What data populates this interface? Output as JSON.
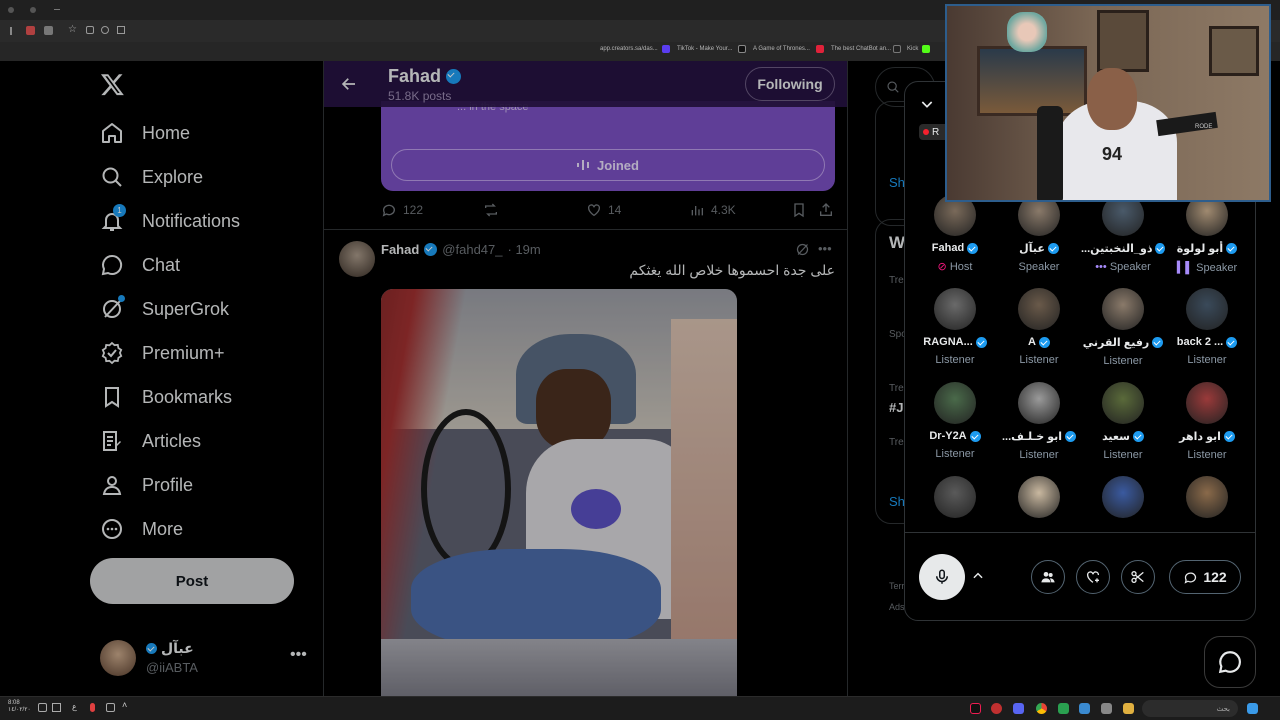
{
  "browser": {
    "bookmarks": [
      {
        "label": "app.creators.sa/das...",
        "icon_color": "#444444"
      },
      {
        "label": "TikTok - Make Your...",
        "icon_color": "#5a3df0"
      },
      {
        "label": "A Game of Thrones...",
        "icon_color": "#111111"
      },
      {
        "label": "The best ChatBot an...",
        "icon_color": "#e0223a"
      },
      {
        "label": "Kick",
        "icon_color": "#53fc18"
      }
    ]
  },
  "nav": {
    "items": [
      {
        "label": "Home",
        "icon": "home-icon"
      },
      {
        "label": "Explore",
        "icon": "search-icon"
      },
      {
        "label": "Notifications",
        "icon": "bell-icon",
        "badge": "1"
      },
      {
        "label": "Chat",
        "icon": "chat-icon"
      },
      {
        "label": "SuperGrok",
        "icon": "grok-icon"
      },
      {
        "label": "Premium+",
        "icon": "premium-icon"
      },
      {
        "label": "Bookmarks",
        "icon": "bookmark-icon"
      },
      {
        "label": "Articles",
        "icon": "articles-icon"
      },
      {
        "label": "Profile",
        "icon": "person-icon"
      },
      {
        "label": "More",
        "icon": "more-circle-icon"
      }
    ],
    "post_label": "Post",
    "account": {
      "name": "عبآل",
      "handle": "@iiABTA"
    }
  },
  "profile_header": {
    "name": "Fahad",
    "posts": "51.8K posts",
    "follow_label": "Following"
  },
  "space_card": {
    "participants_text": "... in the space",
    "joined_label": "Joined"
  },
  "tweet1_actions": {
    "replies": "122",
    "likes": "14",
    "views": "4.3K"
  },
  "tweet2": {
    "name": "Fahad",
    "handle": "@fahd47_",
    "time": "· 19m",
    "text": "على جدة احسموها خلاص الله يغثكم"
  },
  "right": {
    "side_labels": [
      "Sh",
      "W",
      "Tre",
      "Spo",
      "Tre",
      "#Ju",
      "Tre",
      "Sh",
      "Terr",
      "Ads"
    ]
  },
  "space_panel": {
    "live_badge": "R",
    "participants": [
      {
        "name": "Fahad",
        "role": "Host",
        "role_icon": "host-icon",
        "color": "#7a6a5a"
      },
      {
        "name": "عبآل",
        "role": "Speaker",
        "color": "#8a7a6a"
      },
      {
        "name": "...ذو_النخبتين",
        "role": "Speaker",
        "role_icon": "dots-icon",
        "color": "#4a5a6a"
      },
      {
        "name": "أبو لولوة",
        "role": "Speaker",
        "role_icon": "audio-bars-icon",
        "color": "#a08a70"
      },
      {
        "name": "RAGNA...",
        "role": "Listener",
        "color": "#6a6a6a"
      },
      {
        "name": "A",
        "role": "Listener",
        "color": "#6a5a4a"
      },
      {
        "name": "رفيع القرني",
        "role": "Listener",
        "color": "#8a7a6a"
      },
      {
        "name": "back 2 ...",
        "role": "Listener",
        "color": "#3a4a5a"
      },
      {
        "name": "Dr-Y2A",
        "role": "Listener",
        "color": "#4a6a4a"
      },
      {
        "name": "...ابو خـلـف",
        "role": "Listener",
        "color": "#9a9a9a"
      },
      {
        "name": "سعيد",
        "role": "Listener",
        "color": "#5a6a3a"
      },
      {
        "name": "ابو داهر",
        "role": "Listener",
        "color": "#9a3a3a"
      },
      {
        "name": "",
        "role": "",
        "color": "#5a5a5a"
      },
      {
        "name": "",
        "role": "",
        "color": "#c9b8a0"
      },
      {
        "name": "",
        "role": "",
        "color": "#3a5aa0"
      },
      {
        "name": "",
        "role": "",
        "color": "#8a6a4a"
      }
    ],
    "comments_count": "122"
  },
  "webcam": {
    "mic_brand": "RODE"
  },
  "taskbar": {
    "left_text": "ع",
    "clock": "8:08",
    "date": "١٤/٠٢/٢٠",
    "search_placeholder": "بحث"
  }
}
